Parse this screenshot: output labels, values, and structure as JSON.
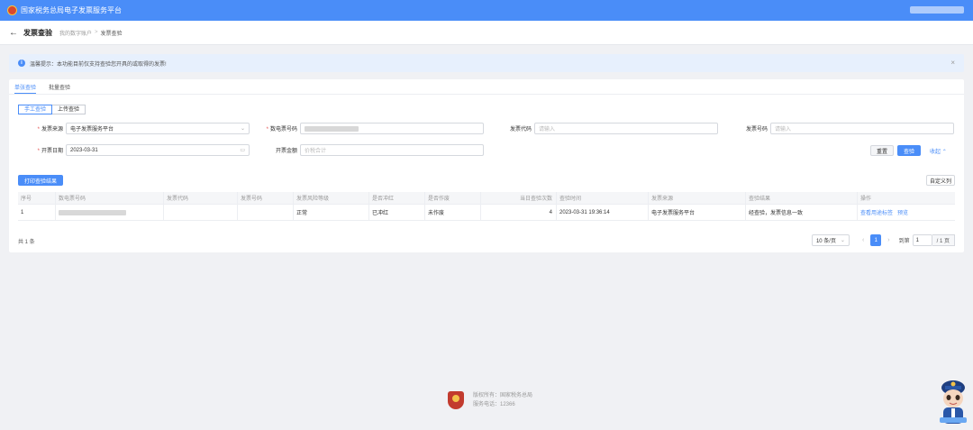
{
  "app": {
    "title": "国家税务总局电子发票服务平台"
  },
  "header": {
    "page_title": "发票查验",
    "breadcrumb": [
      "我的数字账户",
      "发票查验"
    ],
    "crumb_sep": ">"
  },
  "notice": {
    "text": "温馨提示：本功能目前仅支持查验您开具的或取得的发票!",
    "close": "×"
  },
  "tabs": [
    {
      "label": "单张查验",
      "active": true
    },
    {
      "label": "批量查验",
      "active": false
    }
  ],
  "mode": [
    {
      "label": "手工查验",
      "active": true
    },
    {
      "label": "上传查验",
      "active": false
    }
  ],
  "form": {
    "source_label": "发票来源",
    "source_value": "电子发票服务平台",
    "number_label": "数电票号码",
    "code_label": "发票代码",
    "code_placeholder": "请输入",
    "invoice_no_label": "发票号码",
    "invoice_no_placeholder": "请输入",
    "date_label": "开票日期",
    "date_value": "2023-03-31",
    "amount_label": "开票金额",
    "amount_placeholder": "价税合计",
    "reset": "重置",
    "query": "查验",
    "collapse": "收起"
  },
  "actions": {
    "print": "打印查验结果",
    "custom_columns": "自定义列"
  },
  "table": {
    "columns": [
      "序号",
      "数电票号码",
      "发票代码",
      "发票号码",
      "发票风险等级",
      "是否冲红",
      "是否作废",
      "当日查验次数",
      "查验时间",
      "发票来源",
      "查验结果",
      "操作"
    ],
    "rows": [
      {
        "index": "1",
        "risk": "正常",
        "red": "已冲红",
        "void": "未作废",
        "count": "4",
        "time": "2023-03-31 19:36:14",
        "source": "电子发票服务平台",
        "result": "经查验，发票信息一致",
        "op_view": "查看用途标签",
        "op_preview": "预览"
      }
    ]
  },
  "pager": {
    "total": "共 1 条",
    "size": "10 条/页",
    "prev": "‹",
    "next": "›",
    "current": "1",
    "goto": "到第",
    "goto_value": "1",
    "total_pages": "/ 1 页"
  },
  "footer": {
    "owner": "版权所有：国家税务总局",
    "phone": "服务电话：12366"
  },
  "colors": {
    "brand": "#4a8df8",
    "required": "#e34d4d"
  }
}
